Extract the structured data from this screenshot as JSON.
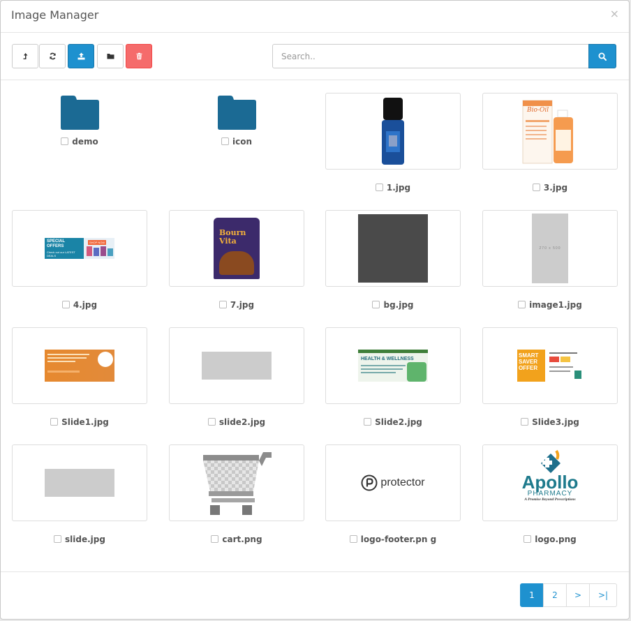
{
  "modal": {
    "title": "Image Manager",
    "close_label": "×"
  },
  "toolbar": {
    "buttons": [
      {
        "name": "parent-button",
        "icon": "level-up-icon"
      },
      {
        "name": "refresh-button",
        "icon": "refresh-icon"
      },
      {
        "name": "upload-button",
        "icon": "upload-icon"
      },
      {
        "name": "new-folder-button",
        "icon": "folder-icon"
      },
      {
        "name": "delete-button",
        "icon": "trash-icon"
      }
    ],
    "search_placeholder": "Search..",
    "search_value": ""
  },
  "files": {
    "folders": [
      {
        "label": "demo"
      },
      {
        "label": "icon"
      }
    ],
    "images": [
      {
        "label": "1.jpg"
      },
      {
        "label": "3.jpg"
      },
      {
        "label": "4.jpg"
      },
      {
        "label": "7.jpg"
      },
      {
        "label": "bg.jpg"
      },
      {
        "label": "image1.jpg"
      },
      {
        "label": "Slide1.jpg"
      },
      {
        "label": "slide2.jpg"
      },
      {
        "label": "Slide2.jpg"
      },
      {
        "label": "Slide3.jpg"
      },
      {
        "label": "slide.jpg"
      },
      {
        "label": "cart.png"
      },
      {
        "label": "logo-footer.pn g"
      },
      {
        "label": "logo.png"
      }
    ]
  },
  "thumb_text": {
    "bio_oil": "Bio-Oil",
    "special_offers": "SPECIAL OFFERS",
    "shop_now": "SHOP NOW",
    "check_out": "Check out our LATEST DEALS",
    "bournvita": "Bourn Vita",
    "dimensions": "270 x 500",
    "health_wellness": "HEALTH & WELLNESS",
    "smart_saver": "SMART SAVER OFFER",
    "protector": "protector",
    "apollo": "Apollo",
    "pharmacy": "PHARMACY",
    "apollo_tagline": "A Promise Beyond Prescriptions"
  },
  "pagination": {
    "pages": [
      "1",
      "2"
    ],
    "next": ">",
    "last": ">|",
    "active": "1"
  },
  "colors": {
    "primary": "#1e91cf",
    "danger": "#f56b6b",
    "folder": "#1b6a94"
  }
}
